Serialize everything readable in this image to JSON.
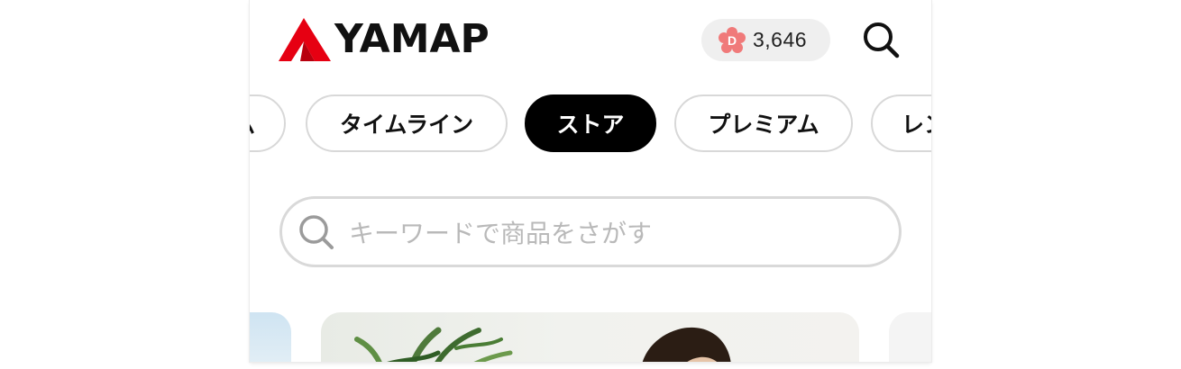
{
  "header": {
    "logo_text": "YAMAP",
    "logo_color": "#e60012",
    "points": "3,646",
    "points_badge_letter": "D",
    "points_badge_color": "#f07a7a",
    "search_icon": "search-icon"
  },
  "tabs": [
    {
      "label": "ム",
      "active": false
    },
    {
      "label": "タイムライン",
      "active": false
    },
    {
      "label": "ストア",
      "active": true
    },
    {
      "label": "プレミアム",
      "active": false
    },
    {
      "label": "レン",
      "active": false
    }
  ],
  "search": {
    "placeholder": "キーワードで商品をさがす"
  },
  "banners": {
    "items": [
      "left-card",
      "main-banner",
      "right-card"
    ]
  }
}
